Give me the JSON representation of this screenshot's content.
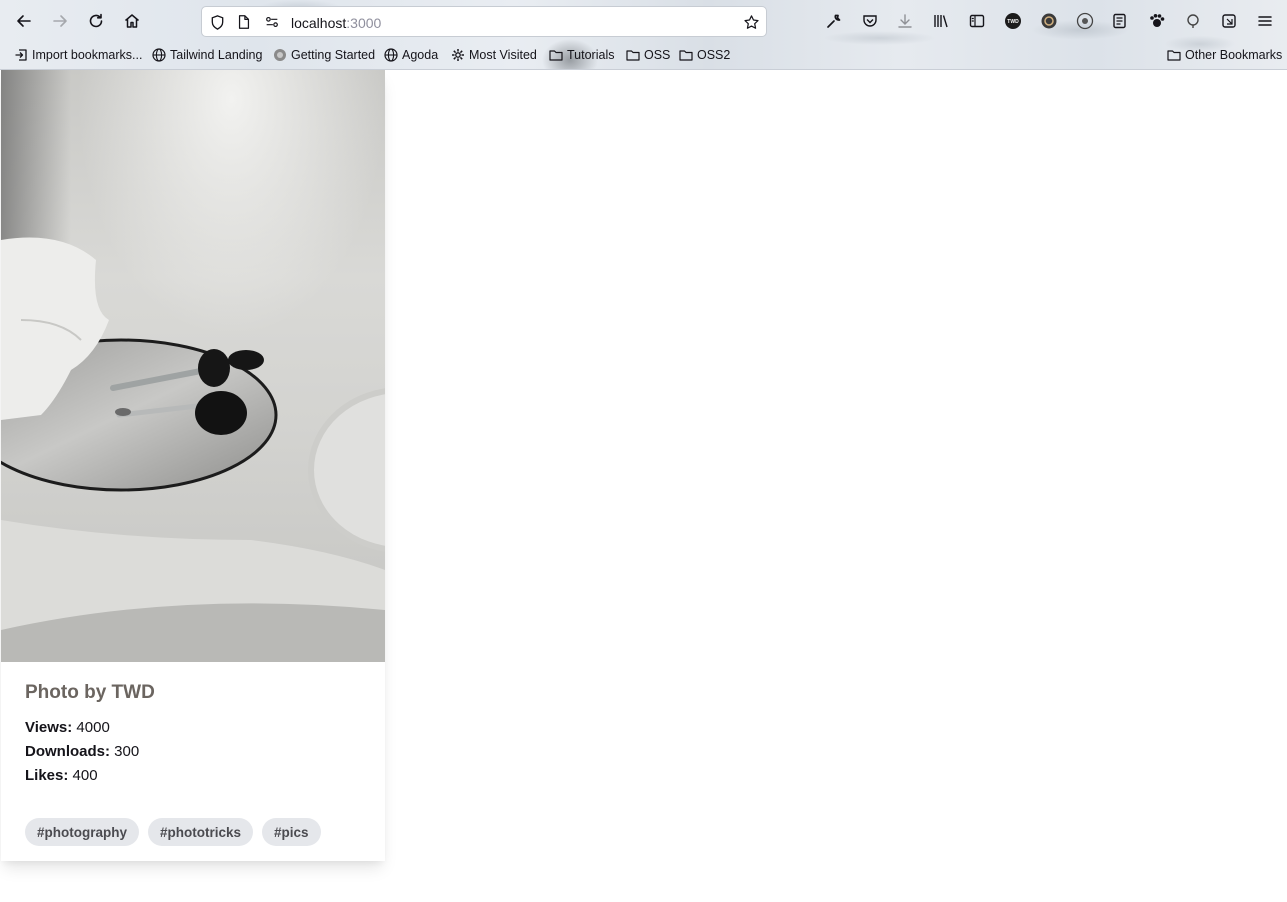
{
  "browser": {
    "url_host": "localhost",
    "url_port": ":3000",
    "bookmarks": [
      {
        "label": "Import bookmarks...",
        "icon": "import-icon"
      },
      {
        "label": "Tailwind Landing",
        "icon": "globe-icon"
      },
      {
        "label": "Getting Started",
        "icon": "firefox-icon"
      },
      {
        "label": "Agoda",
        "icon": "globe-icon"
      },
      {
        "label": "Most Visited",
        "icon": "gear-icon"
      },
      {
        "label": "Tutorials",
        "icon": "folder-icon"
      },
      {
        "label": "OSS",
        "icon": "folder-icon"
      },
      {
        "label": "OSS2",
        "icon": "folder-icon"
      }
    ],
    "other_bookmarks": "Other Bookmarks",
    "profile_badge": "TWD"
  },
  "card": {
    "title": "Photo by TWD",
    "stats": [
      {
        "label": "Views:",
        "value": "4000"
      },
      {
        "label": "Downloads:",
        "value": "300"
      },
      {
        "label": "Likes:",
        "value": "400"
      }
    ],
    "tags": [
      "#photography",
      "#phototricks",
      "#pics"
    ]
  }
}
